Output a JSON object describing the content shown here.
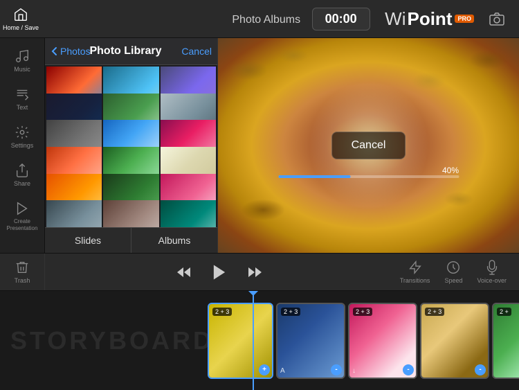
{
  "app": {
    "title": "Photo Albums",
    "timer": "00:00",
    "brand": {
      "wi": "Wi",
      "point": "Point",
      "pro": "PRO"
    }
  },
  "sidebar": {
    "items": [
      {
        "id": "home",
        "label": "Home / Save"
      },
      {
        "id": "music",
        "label": "Music"
      },
      {
        "id": "text",
        "label": "Text"
      },
      {
        "id": "settings",
        "label": "Settings"
      },
      {
        "id": "share",
        "label": "Share"
      },
      {
        "id": "create",
        "label": "Create Presentation"
      }
    ]
  },
  "photo_panel": {
    "back_label": "Photos",
    "title": "Photo Library",
    "cancel_label": "Cancel",
    "tabs": [
      {
        "id": "slides",
        "label": "Slides"
      },
      {
        "id": "albums",
        "label": "Albums"
      }
    ]
  },
  "preview": {
    "cancel_label": "Cancel",
    "progress_percent": "40%"
  },
  "controls": {
    "trash_label": "Trash",
    "rewind_label": "Rewind",
    "play_label": "Play",
    "fast_forward_label": "Fast Forward",
    "transitions_label": "Transitions",
    "speed_label": "Speed",
    "voiceover_label": "Voice-over"
  },
  "storyboard": {
    "label": "STORYBOARD",
    "slides": [
      {
        "id": 1,
        "badge": "2 + 3",
        "active": true,
        "bg": "sb1",
        "icon": "+"
      },
      {
        "id": 2,
        "badge": "2 + 3",
        "active": false,
        "bg": "sb2",
        "icon": "A"
      },
      {
        "id": 3,
        "badge": "2 + 3",
        "active": false,
        "bg": "sb3",
        "icon": "↓"
      },
      {
        "id": 4,
        "badge": "2 + 3",
        "active": false,
        "bg": "sb4",
        "icon": "-"
      },
      {
        "id": 5,
        "badge": "2 +",
        "active": false,
        "bg": "sb5",
        "icon": "-"
      }
    ]
  }
}
